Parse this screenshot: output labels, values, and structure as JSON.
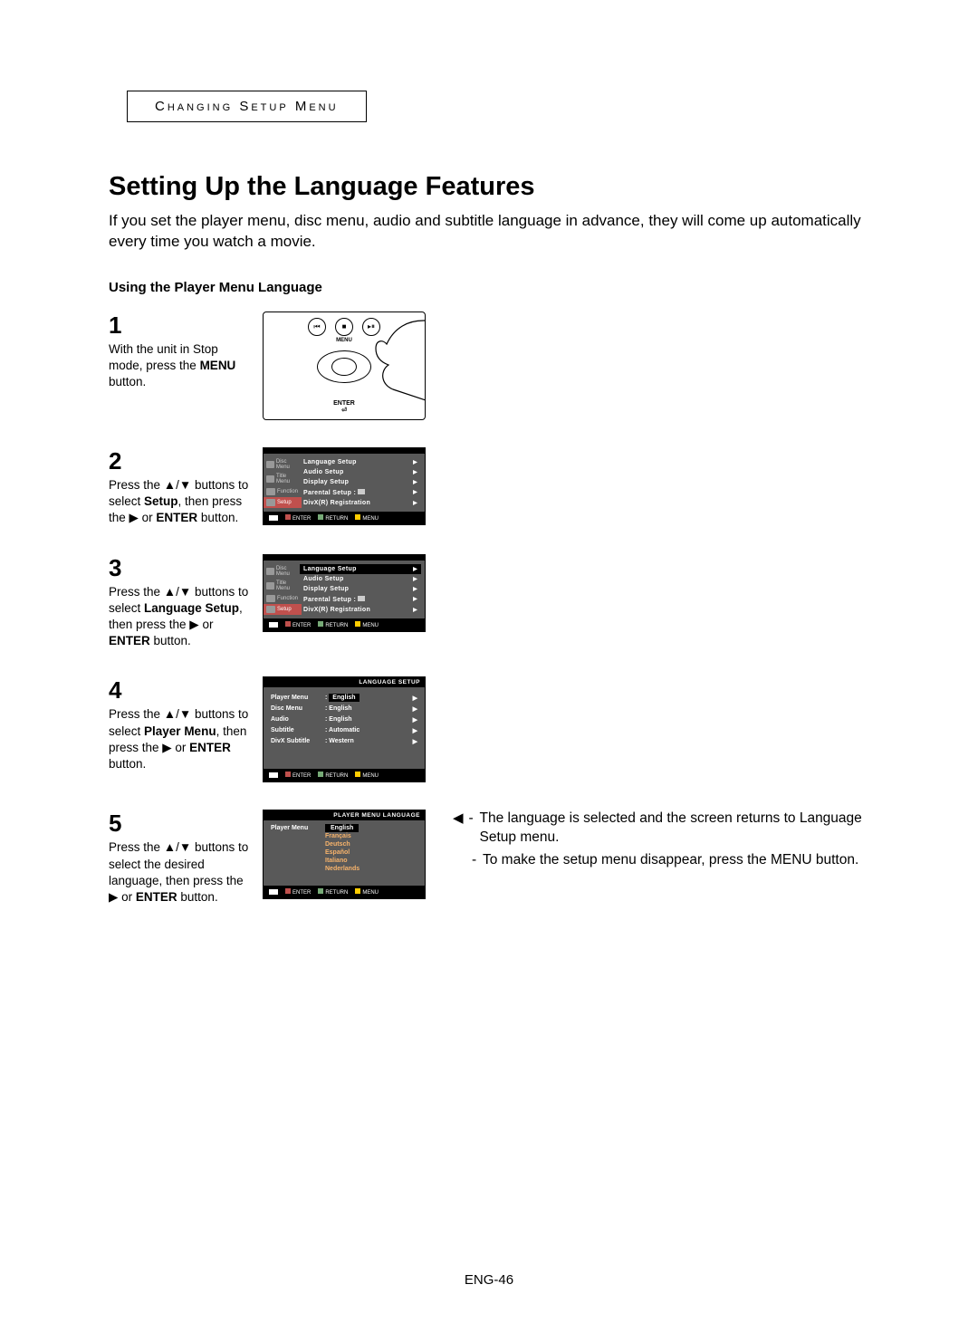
{
  "header": {
    "section": "Changing Setup Menu"
  },
  "title": "Setting Up the Language Features",
  "intro": "If you set the player menu, disc menu, audio and subtitle language in advance, they will come up automatically every time you watch a movie.",
  "subhead": "Using the Player Menu Language",
  "steps": {
    "s1": {
      "num": "1",
      "t1": "With the unit in Stop mode, press the ",
      "b1": "MENU",
      "t2": " button."
    },
    "s2": {
      "num": "2",
      "t1": "Press the ▲/▼ buttons to select ",
      "b1": "Setup",
      "t2": ", then press the ▶ or ",
      "b2": "ENTER",
      "t3": " button."
    },
    "s3": {
      "num": "3",
      "t1": "Press the ▲/▼ buttons to select ",
      "b1": "Language Setup",
      "t2": ", then press the ▶ or ",
      "b2": "ENTER",
      "t3": " button."
    },
    "s4": {
      "num": "4",
      "t1": "Press the ▲/▼ buttons to select ",
      "b1": "Player Menu",
      "t2": ", then press the ▶ or ",
      "b2": "ENTER",
      "t3": " button."
    },
    "s5": {
      "num": "5",
      "t1": "Press the ▲/▼ buttons to select the desired language, then press the ▶ or ",
      "b1": "ENTER",
      "t2": " button."
    }
  },
  "screen_side": {
    "items": [
      "Disc Menu",
      "Title Menu",
      "Function",
      "Setup"
    ],
    "icons": [
      "disc-icon",
      "title-icon",
      "function-icon",
      "gear-icon"
    ]
  },
  "setup_menu": {
    "items": [
      "Language Setup",
      "Audio Setup",
      "Display Setup",
      "Parental Setup  :",
      "DivX(R) Registration"
    ]
  },
  "footer": {
    "enter": "ENTER",
    "return": "RETURN",
    "menu": "MENU"
  },
  "lang_setup": {
    "title": "LANGUAGE SETUP",
    "rows": [
      {
        "l": "Player Menu",
        "v": "English"
      },
      {
        "l": "Disc Menu",
        "v": "English"
      },
      {
        "l": "Audio",
        "v": "English"
      },
      {
        "l": "Subtitle",
        "v": "Automatic"
      },
      {
        "l": "DivX Subtitle",
        "v": "Western"
      }
    ]
  },
  "player_menu_lang": {
    "title": "PLAYER MENU LANGUAGE",
    "label": "Player Menu",
    "options": [
      "English",
      "Français",
      "Deutsch",
      "Español",
      "Italiano",
      "Nederlands"
    ]
  },
  "notes": {
    "n1": "The language is selected and the screen returns to Language Setup menu.",
    "n2": "To make the setup menu disappear, press the MENU button."
  },
  "remote": {
    "enter": "ENTER",
    "menu": "MENU"
  },
  "page": "ENG-46"
}
